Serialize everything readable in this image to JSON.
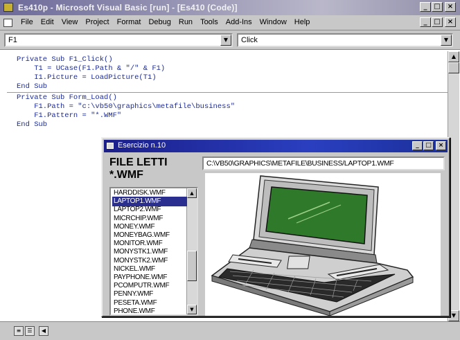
{
  "window": {
    "title": "Es410p - Microsoft Visual Basic [run] - [Es410 (Code)]",
    "minimize": "_",
    "maximize": "□",
    "close": "×"
  },
  "menu": {
    "items": [
      "File",
      "Edit",
      "View",
      "Project",
      "Format",
      "Debug",
      "Run",
      "Tools",
      "Add-Ins",
      "Window",
      "Help"
    ]
  },
  "code_window": {
    "object_combo": "F1",
    "procedure_combo": "Click",
    "lines": [
      "Private Sub F1_Click()",
      "    T1 = UCase(F1.Path & \"/\" & F1)",
      "    I1.Picture = LoadPicture(T1)",
      "End Sub",
      "Private Sub Form_Load()",
      "    F1.Path = \"c:\\vb50\\graphics\\metafile\\business\"",
      "    F1.Pattern = \"*.WMF\"",
      "End Sub"
    ]
  },
  "dialog": {
    "title": "Esercizio n.10",
    "caption": "FILE LETTI\n*.WMF",
    "path_text": "C:\\VB50\\GRAPHICS\\METAFILE\\BUSINESS/LAPTOP1.WMF",
    "files": [
      "HARDDISK.WMF",
      "LAPTOP1.WMF",
      "LAPTOP2.WMF",
      "MICRCHIP.WMF",
      "MONEY.WMF",
      "MONEYBAG.WMF",
      "MONITOR.WMF",
      "MONYSTK1.WMF",
      "MONYSTK2.WMF",
      "NICKEL.WMF",
      "PAYPHONE.WMF",
      "PCOMPUTR.WMF",
      "PENNY.WMF",
      "PESETA.WMF",
      "PHONE.WMF"
    ],
    "selected_file": "LAPTOP1.WMF",
    "picture_icon": "laptop-picture"
  },
  "colors": {
    "code_text": "#1a2a9a",
    "dialog_title": "#1b1f8a",
    "selection": "#2a2f8f",
    "laptop_screen": "#2f7a2a"
  }
}
